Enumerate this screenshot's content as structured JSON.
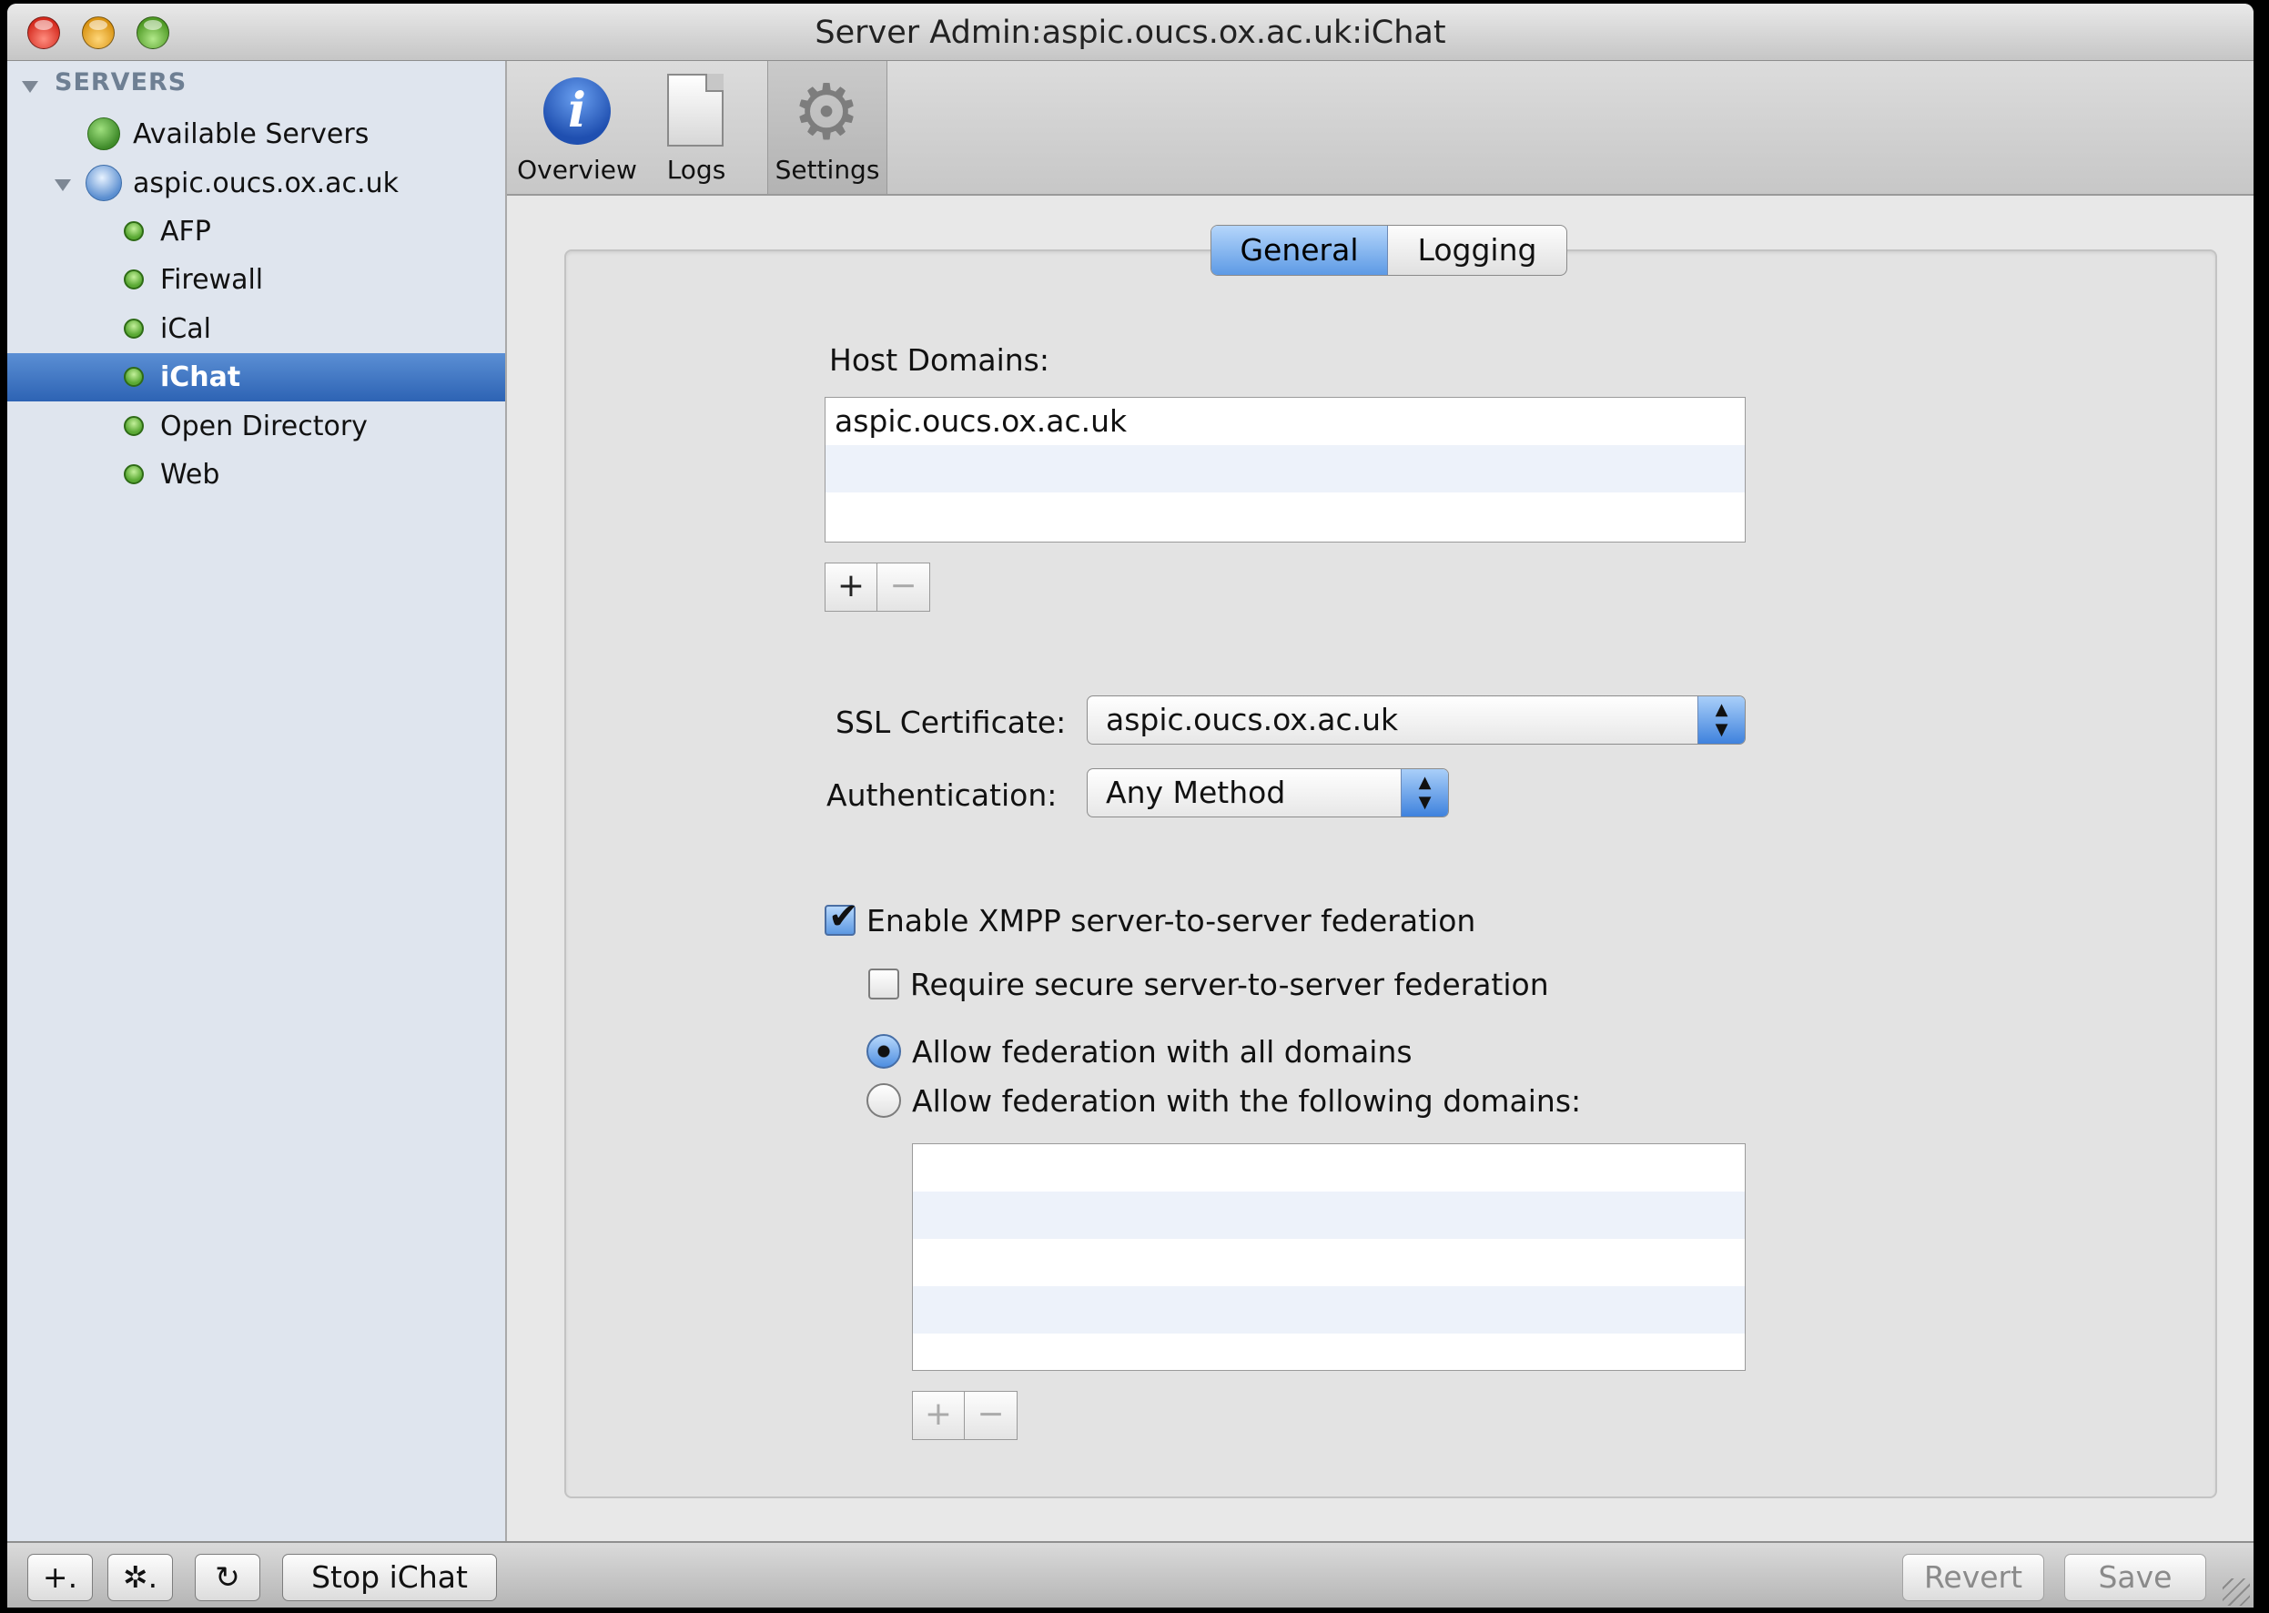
{
  "window": {
    "title": "Server Admin:aspic.oucs.ox.ac.uk:iChat"
  },
  "sidebar": {
    "section_title": "SERVERS",
    "available_servers": "Available Servers",
    "server": "aspic.oucs.ox.ac.uk",
    "services": [
      {
        "label": "AFP",
        "status": "running"
      },
      {
        "label": "Firewall",
        "status": "running"
      },
      {
        "label": "iCal",
        "status": "running"
      },
      {
        "label": "iChat",
        "status": "running",
        "selected": true
      },
      {
        "label": "Open Directory",
        "status": "running"
      },
      {
        "label": "Web",
        "status": "running"
      }
    ]
  },
  "toolbar": {
    "overview": "Overview",
    "logs": "Logs",
    "settings": "Settings",
    "active": "Settings"
  },
  "tabs": {
    "general": "General",
    "logging": "Logging",
    "active": "General"
  },
  "form": {
    "host_domains_label": "Host Domains:",
    "host_domains": [
      "aspic.oucs.ox.ac.uk",
      "",
      ""
    ],
    "add_symbol": "+",
    "remove_symbol": "−",
    "ssl_label": "SSL Certificate:",
    "ssl_value": "aspic.oucs.ox.ac.uk",
    "auth_label": "Authentication:",
    "auth_value": "Any Method",
    "enable_federation": {
      "label": "Enable XMPP server-to-server federation",
      "checked": true
    },
    "require_secure": {
      "label": "Require secure server-to-server federation",
      "checked": false
    },
    "allow_all": {
      "label": "Allow federation with all domains",
      "selected": true
    },
    "allow_following": {
      "label": "Allow federation with the following domains:",
      "selected": false
    },
    "federation_domains": [
      "",
      "",
      "",
      "",
      ""
    ]
  },
  "bottom": {
    "add": "+.",
    "action": "✲.",
    "refresh": "↻",
    "stop": "Stop iChat",
    "revert": "Revert",
    "save": "Save"
  }
}
